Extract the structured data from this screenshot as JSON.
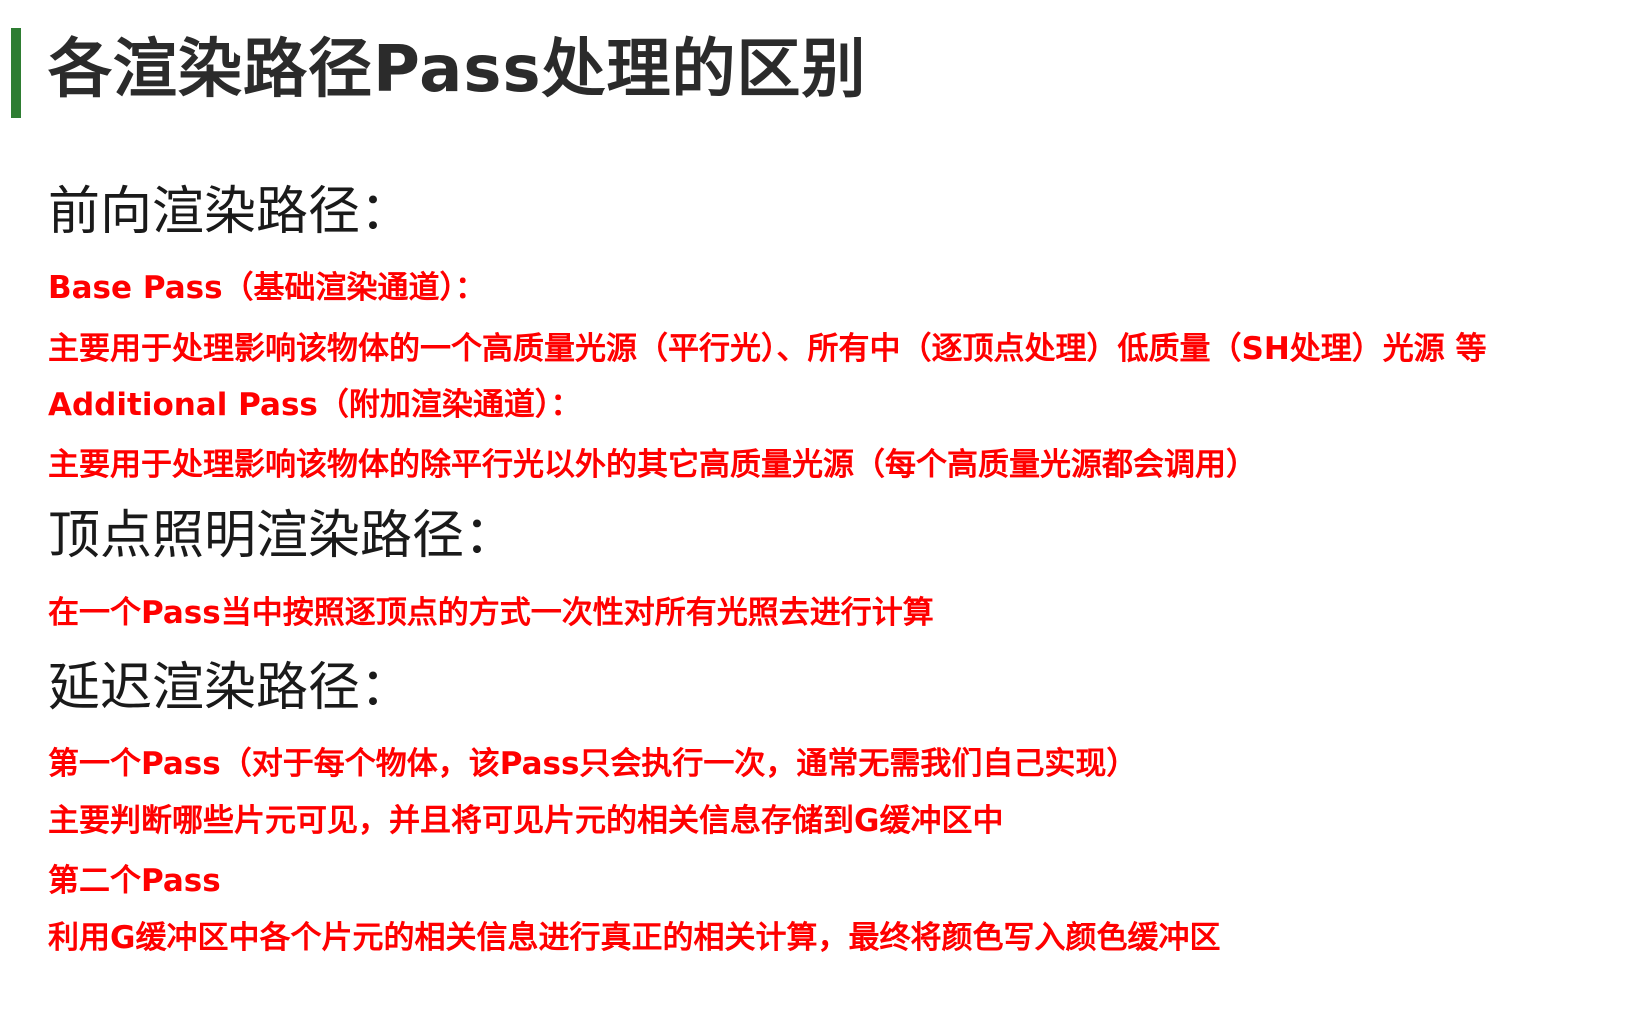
{
  "title": "各渲染路径Pass处理的区别",
  "forward": {
    "heading": "前向渲染路径：",
    "lines": [
      "Base Pass（基础渲染通道）：",
      "主要用于处理影响该物体的一个高质量光源（平行光）、所有中（逐顶点处理）低质量（SH处理）光源 等",
      "Additional Pass（附加渲染通道）：",
      "主要用于处理影响该物体的除平行光以外的其它高质量光源（每个高质量光源都会调用）"
    ]
  },
  "vertex": {
    "heading": "顶点照明渲染路径：",
    "lines": [
      "在一个Pass当中按照逐顶点的方式一次性对所有光照去进行计算"
    ]
  },
  "deferred": {
    "heading": "延迟渲染路径：",
    "lines": [
      "第一个Pass（对于每个物体，该Pass只会执行一次，通常无需我们自己实现）",
      "主要判断哪些片元可见，并且将可见片元的相关信息存储到G缓冲区中",
      "第二个Pass",
      "利用G缓冲区中各个片元的相关信息进行真正的相关计算，最终将颜色写入颜色缓冲区"
    ]
  },
  "colors": {
    "accent_bar": "#2e7d32",
    "highlight_text": "#ff0000",
    "title_text": "#2b2b2b",
    "heading_text": "#1a1a1a"
  }
}
